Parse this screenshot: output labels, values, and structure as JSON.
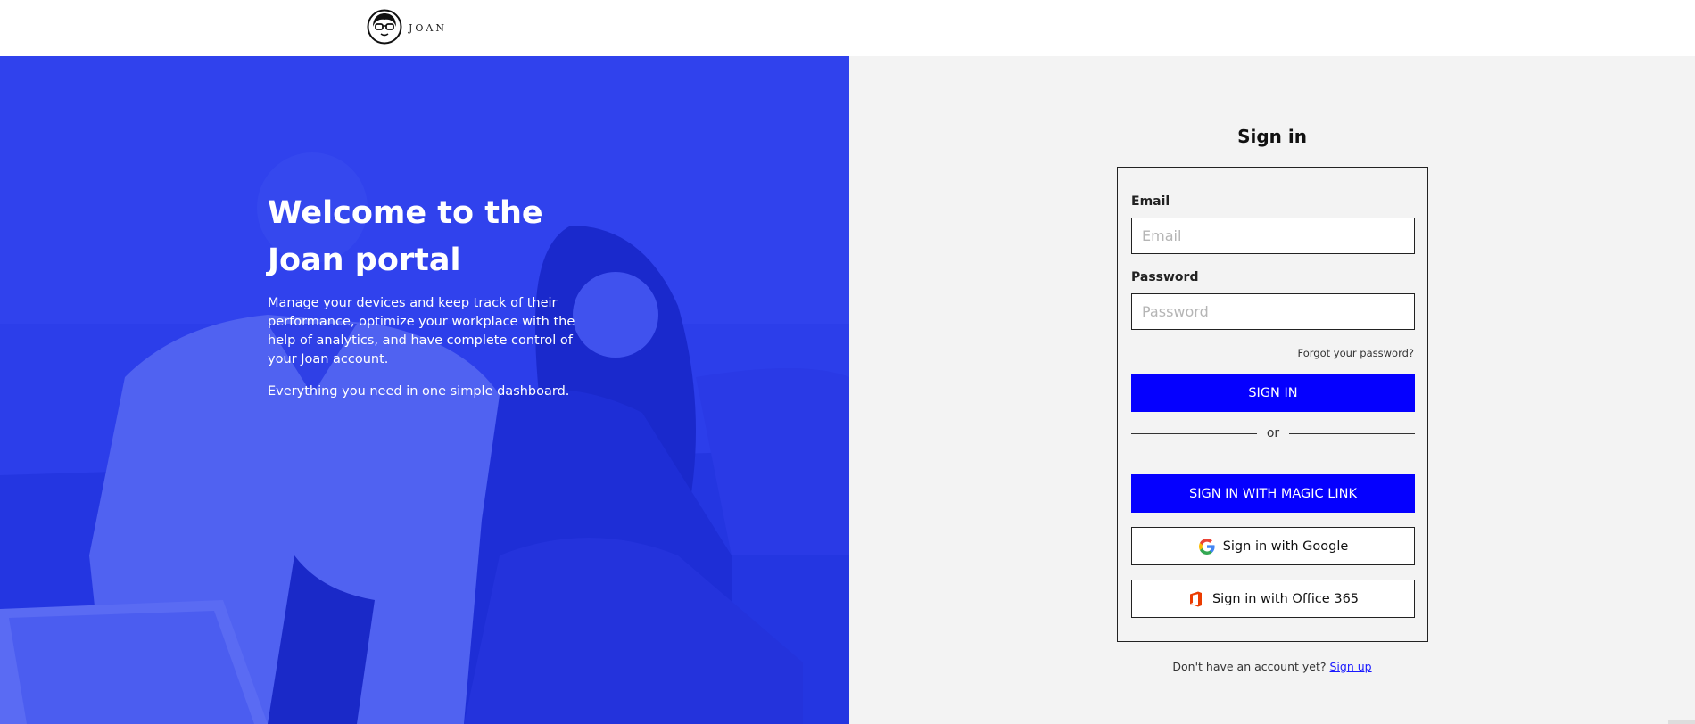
{
  "header": {
    "logo_text": "JOAN"
  },
  "hero": {
    "title_line1": "Welcome to the",
    "title_line2": "Joan portal",
    "paragraph1": "Manage your devices and keep track of their performance, optimize your workplace with the help of analytics, and have complete control of your Joan account.",
    "paragraph2": "Everything you need in one simple dashboard."
  },
  "signin": {
    "title": "Sign in",
    "email_label": "Email",
    "email_placeholder": "Email",
    "email_value": "",
    "password_label": "Password",
    "password_placeholder": "Password",
    "password_value": "",
    "forgot_link": "Forgot your password?",
    "submit_label": "SIGN IN",
    "divider_text": "or",
    "magic_link_label": "SIGN IN WITH MAGIC LINK",
    "google_label": "Sign in with Google",
    "office_label": "Sign in with Office 365",
    "no_account_text": "Don't have an account yet?",
    "signup_link": "Sign up"
  },
  "colors": {
    "hero_blue": "#2b3ce8",
    "primary_button": "#0500ff",
    "right_panel_bg": "#f3f3f3"
  },
  "icons": {
    "logo": "joan-face-logo",
    "google": "google-g-icon",
    "office": "office-365-icon"
  }
}
